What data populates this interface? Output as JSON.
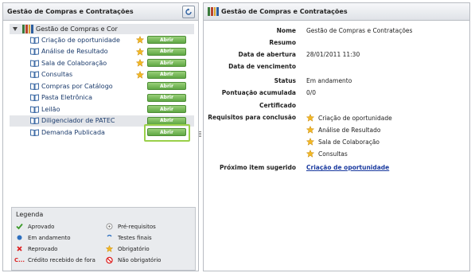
{
  "left_panel": {
    "title": "Gestão de Compras e Contratações"
  },
  "tree": {
    "root_label": "Gestão de Compras e Cor",
    "items": [
      {
        "label": "Criação de oportunidade",
        "star": true,
        "button": "Abrir"
      },
      {
        "label": "Análise de Resultado",
        "star": true,
        "button": "Abrir"
      },
      {
        "label": "Sala de Colaboração",
        "star": true,
        "button": "Abrir"
      },
      {
        "label": "Consultas",
        "star": true,
        "button": "Abrir"
      },
      {
        "label": "Compras por Catálogo",
        "star": false,
        "button": "Abrir"
      },
      {
        "label": "Pasta Eletrônica",
        "star": false,
        "button": "Abrir"
      },
      {
        "label": "Leilão",
        "star": false,
        "button": "Abrir"
      },
      {
        "label": "Diligenciador de PATEC",
        "star": false,
        "button": "Abrir"
      },
      {
        "label": "Demanda Publicada",
        "star": false,
        "button": "Abrir"
      }
    ]
  },
  "legend": {
    "title": "Legenda",
    "items": {
      "aprovado": "Aprovado",
      "em_andamento": "Em andamento",
      "reprovado": "Reprovado",
      "credito": "Crédito recebido de fora",
      "pre_requisitos": "Pré-requisitos",
      "testes_finais": "Testes finais",
      "obrigatorio": "Obrigatório",
      "nao_obrigatorio": "Não obrigatório"
    }
  },
  "right_panel": {
    "title": "Gestão de Compras e Contratações"
  },
  "details": {
    "nome_label": "Nome",
    "nome": "Gestão de Compras e Contratações",
    "resumo_label": "Resumo",
    "resumo": "",
    "abertura_label": "Data de abertura",
    "abertura": "28/01/2011 11:30",
    "vencimento_label": "Data de vencimento",
    "vencimento": "",
    "status_label": "Status",
    "status": "Em andamento",
    "pontuacao_label": "Pontuação acumulada",
    "pontuacao": "0/0",
    "certificado_label": "Certificado",
    "certificado": "",
    "requisitos_label": "Requisitos para conclusão",
    "requisitos": [
      "Criação de oportunidade",
      "Análise de Resultado",
      "Sala de Colaboração",
      "Consultas"
    ],
    "proximo_label": "Próximo item sugerido",
    "proximo": "Criação de oportunidade"
  },
  "colors": {
    "accent_green": "#5fa744",
    "star": "#f2b824",
    "link": "#1a3a9f"
  }
}
